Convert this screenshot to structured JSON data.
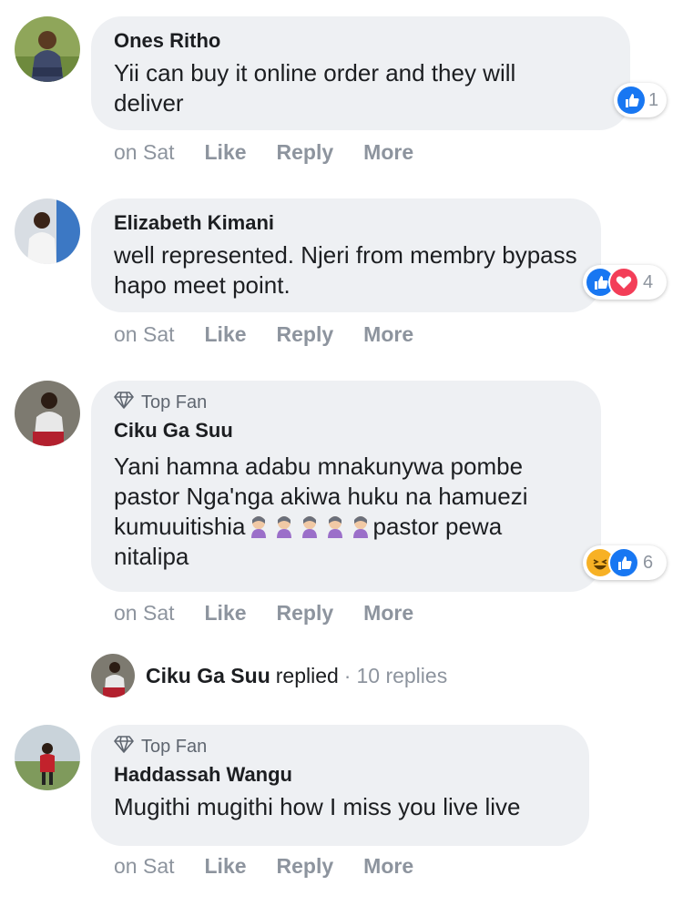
{
  "comments": [
    {
      "author": "Ones Ritho",
      "text": "Yii can buy it online order and they will deliver",
      "reaction_count": "1",
      "time": "on Sat",
      "like": "Like",
      "reply": "Reply",
      "more": "More"
    },
    {
      "author": "Elizabeth Kimani",
      "text": "well represented. Njeri from membry bypass hapo meet point.",
      "reaction_count": "4",
      "time": "on Sat",
      "like": "Like",
      "reply": "Reply",
      "more": "More"
    },
    {
      "badge": "Top Fan",
      "author": "Ciku Ga Suu",
      "text_line1": "Yani hamna adabu mnakunywa pombe",
      "text_line2": "pastor Nga'nga akiwa huku na hamuezi",
      "text_line3a": "kumuuitishia",
      "text_line3b": "pastor pewa",
      "text_line4": "nitalipa",
      "reaction_count": "6",
      "time": "on Sat",
      "like": "Like",
      "reply": "Reply",
      "more": "More"
    },
    {
      "badge": "Top Fan",
      "author": "Haddassah Wangu",
      "text": "Mugithi mugithi how I miss you live live",
      "time": "on Sat",
      "like": "Like",
      "reply": "Reply",
      "more": "More"
    }
  ],
  "replies_row": {
    "name": "Ciku Ga Suu",
    "verb": "replied",
    "dot": "·",
    "count": "10 replies"
  },
  "icons": {
    "like": "like-reaction-icon",
    "love": "love-reaction-icon",
    "haha": "haha-reaction-icon",
    "topfan": "diamond-icon",
    "emoji": "facepalm-emoji-icon"
  },
  "colors": {
    "like": "#1877f2",
    "love": "#f33e58",
    "haha": "#f7b125",
    "bubble": "#eef0f3",
    "meta": "#8d949e"
  }
}
